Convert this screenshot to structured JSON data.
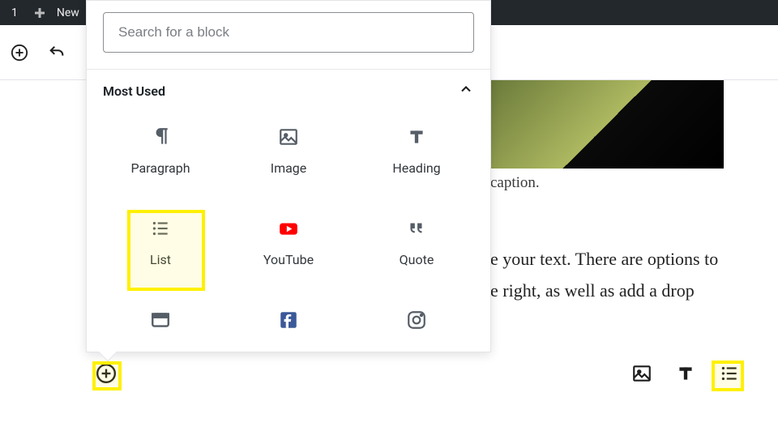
{
  "topbar": {
    "count": "1",
    "new_label": "New"
  },
  "popover": {
    "search_placeholder": "Search for a block",
    "section_title": "Most Used",
    "blocks": [
      {
        "label": "Paragraph",
        "icon": "pilcrow-icon"
      },
      {
        "label": "Image",
        "icon": "image-icon"
      },
      {
        "label": "Heading",
        "icon": "heading-icon"
      },
      {
        "label": "List",
        "icon": "list-icon"
      },
      {
        "label": "YouTube",
        "icon": "youtube-icon"
      },
      {
        "label": "Quote",
        "icon": "quote-icon"
      },
      {
        "label": "",
        "icon": "cover-icon"
      },
      {
        "label": "",
        "icon": "facebook-icon"
      },
      {
        "label": "",
        "icon": "instagram-icon"
      }
    ]
  },
  "editor": {
    "caption_fragment": "caption.",
    "body_line1": "e your text. There are options to",
    "body_line2": "e right, as well as add a drop"
  }
}
